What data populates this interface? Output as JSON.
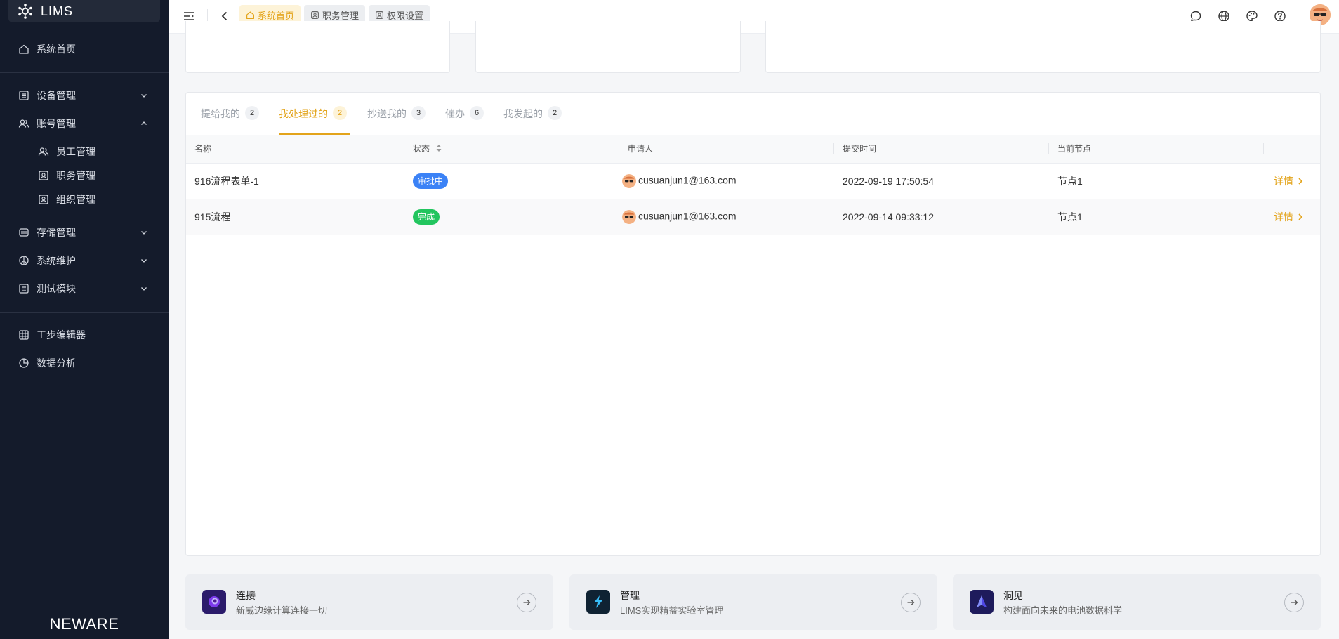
{
  "app": {
    "title": "LIMS",
    "footer_brand": "NEWARE"
  },
  "sidebar": {
    "home": "系统首页",
    "device": "设备管理",
    "account": "账号管理",
    "account_children": [
      "员工管理",
      "职务管理",
      "组织管理"
    ],
    "storage": "存储管理",
    "maintenance": "系统维护",
    "test": "测试模块",
    "step_editor": "工步编辑器",
    "data_analysis": "数据分析"
  },
  "topbar": {
    "tabs": [
      "系统首页",
      "职务管理",
      "权限设置"
    ],
    "active_tab_index": 0
  },
  "panel": {
    "tabs": [
      {
        "label": "提给我的",
        "count": "2"
      },
      {
        "label": "我处理过的",
        "count": "2"
      },
      {
        "label": "抄送我的",
        "count": "3"
      },
      {
        "label": "催办",
        "count": "6"
      },
      {
        "label": "我发起的",
        "count": "2"
      }
    ],
    "active_tab_index": 1,
    "columns": [
      "名称",
      "状态",
      "申请人",
      "提交时间",
      "当前节点",
      ""
    ],
    "rows": [
      {
        "name": "916流程表单-1",
        "status": "审批中",
        "status_color": "#3b82f6",
        "applicant": "cusuanjun1@163.com",
        "time": "2022-09-19 17:50:54",
        "node": "节点1",
        "action": "详情"
      },
      {
        "name": "915流程",
        "status": "完成",
        "status_color": "#22c55e",
        "applicant": "cusuanjun1@163.com",
        "time": "2022-09-14 09:33:12",
        "node": "节点1",
        "action": "详情"
      }
    ]
  },
  "promos": [
    {
      "title": "连接",
      "subtitle": "新威边缘计算连接一切"
    },
    {
      "title": "管理",
      "subtitle": "LIMS实现精益实验室管理"
    },
    {
      "title": "洞见",
      "subtitle": "构建面向未来的电池数据科学"
    }
  ],
  "colors": {
    "accent": "#e3a41b",
    "sidebar_bg": "#141b2b"
  }
}
